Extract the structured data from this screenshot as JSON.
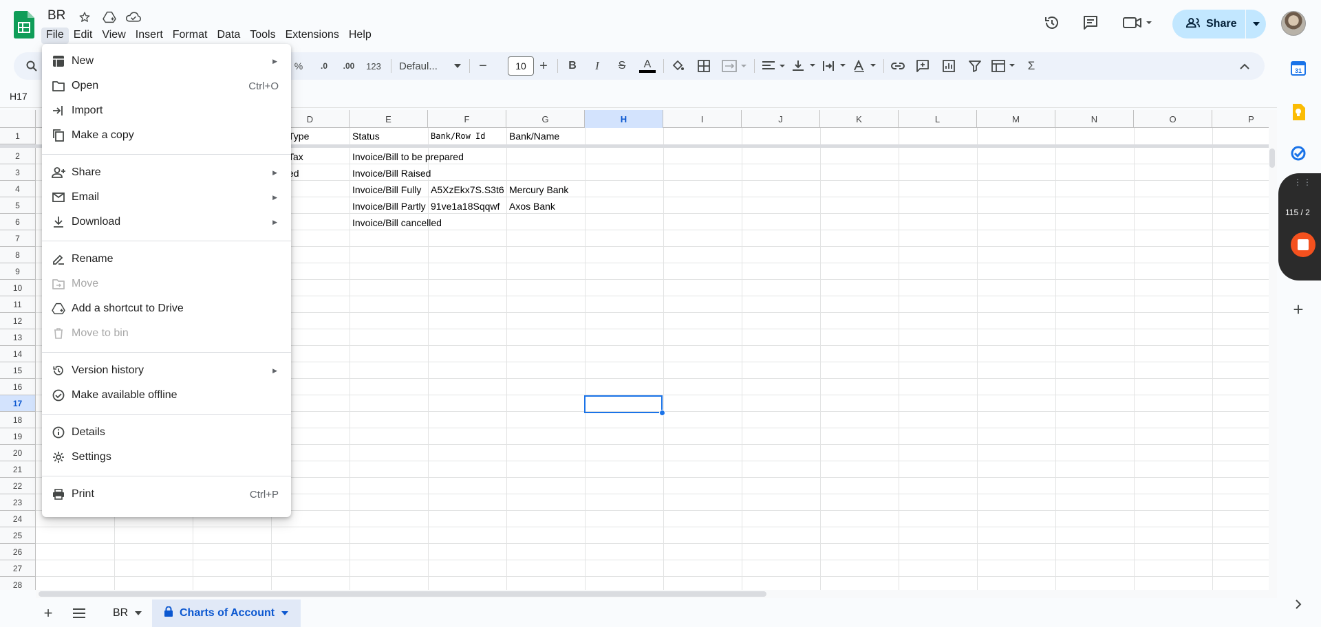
{
  "doc": {
    "title": "BR"
  },
  "menus": [
    "File",
    "Edit",
    "View",
    "Insert",
    "Format",
    "Data",
    "Tools",
    "Extensions",
    "Help"
  ],
  "share": {
    "label": "Share"
  },
  "toolbar": {
    "percent": "%",
    "dec_minus": ".0",
    "dec_plus": ".00",
    "number_format": "123",
    "font": "Defaul...",
    "font_size": "10",
    "bold": "B",
    "italic": "I",
    "strike": "S",
    "text_color": "A",
    "sigma": "Σ"
  },
  "namebox": "H17",
  "columns": [
    "D",
    "E",
    "F",
    "G",
    "H",
    "I",
    "J",
    "K",
    "L",
    "M",
    "N",
    "O",
    "P"
  ],
  "rows": [
    "1",
    "2",
    "3",
    "4",
    "5",
    "6",
    "7",
    "8",
    "9",
    "10",
    "11",
    "12",
    "13",
    "14",
    "15",
    "16",
    "17",
    "18",
    "19",
    "20",
    "21",
    "22",
    "23",
    "24",
    "25",
    "26",
    "27",
    "28"
  ],
  "cells": {
    "d1": "Type",
    "e1": "Status",
    "f1": "Bank/Row Id",
    "g1": "Bank/Name",
    "d2": "Tax",
    "e2": "Invoice/Bill to be prepared",
    "d3": "ed",
    "e3": "Invoice/Bill Raised",
    "e4": "Invoice/Bill Fully",
    "f4": "A5XzEkx7S.S3t6",
    "g4": "Mercury Bank",
    "e5": "Invoice/Bill Partly",
    "f5": "91ve1a18Sqqwf",
    "g5": "Axos Bank",
    "e6": "Invoice/Bill cancelled"
  },
  "sheets": [
    {
      "label": "BR"
    },
    {
      "label": "Charts of Account"
    }
  ],
  "side": {
    "recorder_count": "115 / 2"
  },
  "file_menu": {
    "new": "New",
    "open": "Open",
    "open_sc": "Ctrl+O",
    "import": "Import",
    "copy": "Make a copy",
    "share": "Share",
    "email": "Email",
    "download": "Download",
    "rename": "Rename",
    "move": "Move",
    "shortcut": "Add a shortcut to Drive",
    "bin": "Move to bin",
    "version": "Version history",
    "offline": "Make available offline",
    "details": "Details",
    "settings": "Settings",
    "print": "Print",
    "print_sc": "Ctrl+P"
  },
  "colors": {
    "accent": "#1a73e8",
    "share_bg": "#c2e7ff",
    "sheets_green": "#0f9d58",
    "active_tab": "#0b57d0"
  }
}
